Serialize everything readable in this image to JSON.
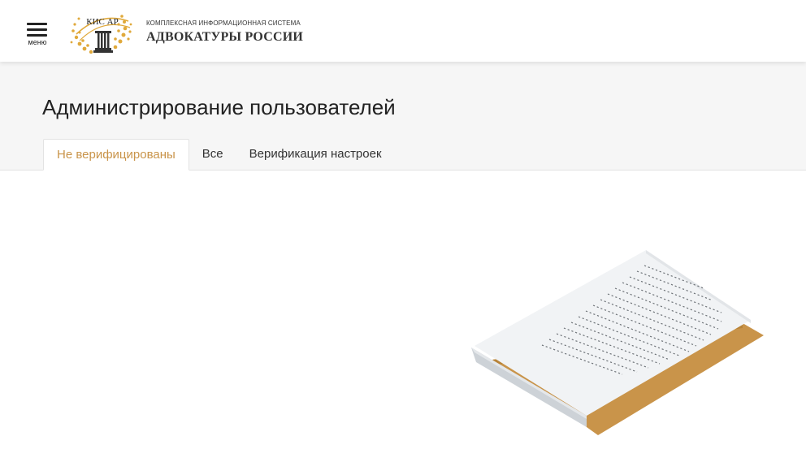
{
  "header": {
    "menu_label": "меню",
    "logo_text": "КИС АР",
    "brand_subtitle": "КОМПЛЕКСНАЯ ИНФОРМАЦИОННАЯ СИСТЕМА",
    "brand_title": "АДВОКАТУРЫ РОССИИ"
  },
  "page": {
    "title": "Администрирование пользователей"
  },
  "tabs": [
    {
      "label": "Не верифицированы",
      "active": true
    },
    {
      "label": "Все",
      "active": false
    },
    {
      "label": "Верификация настроек",
      "active": false
    }
  ],
  "colors": {
    "accent": "#c9944a",
    "folder": "#c9944a",
    "header_band": "#f6f6f6",
    "text": "#222222"
  },
  "icons": {
    "menu": "hamburger-icon",
    "logo": "kisar-logo",
    "empty_state": "empty-document-illustration"
  }
}
